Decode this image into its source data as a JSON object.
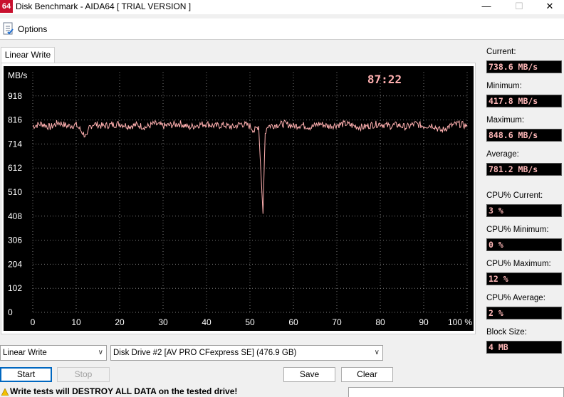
{
  "window": {
    "icon_text": "64",
    "title": "Disk Benchmark - AIDA64  [ TRIAL VERSION ]",
    "minimize": "—",
    "maximize": "☐",
    "close": "✕"
  },
  "menu": {
    "options_label": "Options",
    "options_icon": "options-icon"
  },
  "tabs": [
    "Linear Write"
  ],
  "graph": {
    "timer": "87:22",
    "colors": {
      "background": "#000000",
      "grid": "#7a7a7a",
      "line": "#ffb0b0",
      "labels": "#ffffff",
      "timer": "#ffb0b0"
    }
  },
  "chart_data": {
    "type": "line",
    "title": "",
    "ylabel": "MB/s",
    "xlabel": "",
    "xlim": [
      0,
      100
    ],
    "ylim": [
      0,
      1020
    ],
    "x_ticks": [
      "0",
      "10",
      "20",
      "30",
      "40",
      "50",
      "60",
      "70",
      "80",
      "90",
      "100 %"
    ],
    "y_ticks": [
      "0",
      "102",
      "204",
      "306",
      "408",
      "510",
      "612",
      "714",
      "816",
      "918"
    ],
    "grid": true,
    "series": [
      {
        "name": "",
        "x": [
          0,
          2,
          4,
          6,
          8,
          10,
          12.5,
          13,
          14,
          16,
          18,
          20,
          22,
          24,
          26,
          28,
          30,
          32,
          34,
          36,
          38,
          40,
          42,
          44,
          46,
          48,
          50,
          51,
          52,
          52.5,
          53,
          53.5,
          54,
          56,
          58,
          60,
          62,
          64,
          66,
          68,
          70,
          72,
          74,
          76,
          78,
          80,
          82,
          84,
          86,
          88,
          90,
          92,
          94,
          96,
          98,
          100
        ],
        "y": [
          790,
          800,
          785,
          805,
          790,
          795,
          740,
          785,
          800,
          790,
          795,
          800,
          790,
          795,
          785,
          800,
          790,
          795,
          800,
          785,
          795,
          800,
          790,
          795,
          785,
          800,
          790,
          770,
          790,
          600,
          418,
          760,
          790,
          795,
          800,
          790,
          795,
          785,
          800,
          790,
          795,
          800,
          790,
          785,
          795,
          800,
          790,
          795,
          785,
          800,
          790,
          795,
          770,
          790,
          800,
          790
        ]
      }
    ]
  },
  "stats": [
    {
      "label": "Current:",
      "value": "738.6 MB/s"
    },
    {
      "label": "Minimum:",
      "value": "417.8 MB/s"
    },
    {
      "label": "Maximum:",
      "value": "848.6 MB/s"
    },
    {
      "label": "Average:",
      "value": "781.2 MB/s"
    },
    {
      "label": "CPU% Current:",
      "value": "3 %"
    },
    {
      "label": "CPU% Minimum:",
      "value": "0 %"
    },
    {
      "label": "CPU% Maximum:",
      "value": "12 %"
    },
    {
      "label": "CPU% Average:",
      "value": "2 %"
    },
    {
      "label": "Block Size:",
      "value": "4 MB"
    }
  ],
  "controls": {
    "test_select": "Linear Write",
    "drive_select": "Disk Drive #2  [AV PRO CFexpress SE]  (476.9 GB)",
    "start": "Start",
    "stop": "Stop",
    "save": "Save",
    "clear": "Clear"
  },
  "warning": "Write tests will DESTROY ALL DATA on the tested drive!"
}
